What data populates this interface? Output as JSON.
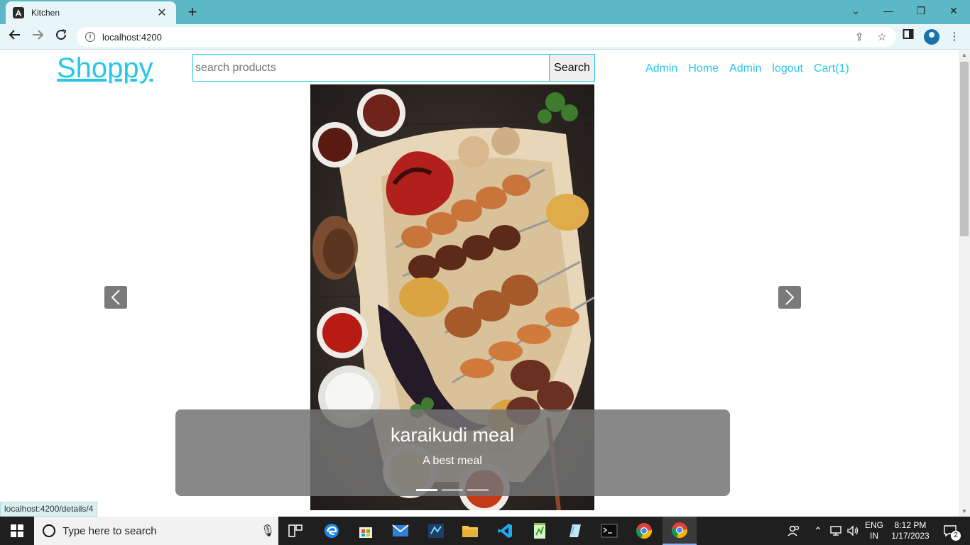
{
  "browser": {
    "tab_title": "Kitchen",
    "tab_close": "✕",
    "new_tab": "+",
    "url": "localhost:4200",
    "status_url": "localhost:4200/details/4",
    "window_controls": {
      "dropdown": "⌄",
      "minimize": "—",
      "restore": "❐",
      "close": "✕"
    }
  },
  "page": {
    "logo": "Shoppy",
    "search": {
      "placeholder": "search products",
      "value": "",
      "button": "Search"
    },
    "nav": [
      "Admin",
      "Home",
      "Admin",
      "logout",
      "Cart(1)"
    ],
    "carousel": {
      "title": "karaikudi meal",
      "subtitle": "A best meal",
      "slide_count": 3,
      "active_index": 0
    },
    "colors": {
      "accent": "#27c8e6",
      "caption_bg": "#737373"
    }
  },
  "taskbar": {
    "search_placeholder": "Type here to search",
    "language": "ENG",
    "region": "IN",
    "time": "8:12 PM",
    "date": "1/17/2023",
    "notification_count": "2",
    "apps": [
      "task-view",
      "edge",
      "store",
      "mail",
      "azure-data-studio",
      "file-explorer",
      "vscode",
      "notepadpp",
      "sticky-app",
      "terminal",
      "chrome",
      "chrome-active"
    ]
  }
}
